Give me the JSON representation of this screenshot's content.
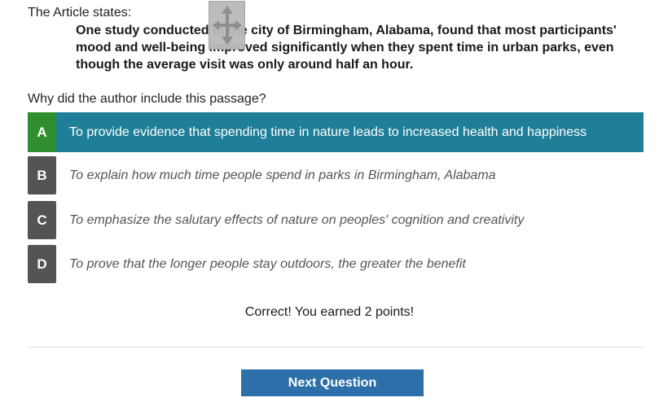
{
  "article": {
    "intro": "The Article states:",
    "quote": "One study conducted in the city of Birmingham, Alabama, found that most participants' mood and well-being improved significantly when they spent time in urban parks, even though the average visit was only around half an hour."
  },
  "question": "Why did the author include this passage?",
  "options": [
    {
      "letter": "A",
      "text": "To provide evidence that spending time in nature leads to increased health and happiness",
      "selected": true
    },
    {
      "letter": "B",
      "text": "To explain how much time people spend in parks in Birmingham, Alabama",
      "selected": false
    },
    {
      "letter": "C",
      "text": "To emphasize the salutary effects of nature on peoples' cognition and creativity",
      "selected": false
    },
    {
      "letter": "D",
      "text": "To prove that the longer people stay outdoors, the greater the benefit",
      "selected": false
    }
  ],
  "feedback": "Correct! You earned 2 points!",
  "next_button": "Next Question",
  "colors": {
    "selected_bg": "#1f7f98",
    "correct_letter_bg": "#2f8f2f",
    "letter_bg": "#545454",
    "button_bg": "#2d6fa8"
  },
  "icons": {
    "move_handle": "move-arrows-icon"
  }
}
